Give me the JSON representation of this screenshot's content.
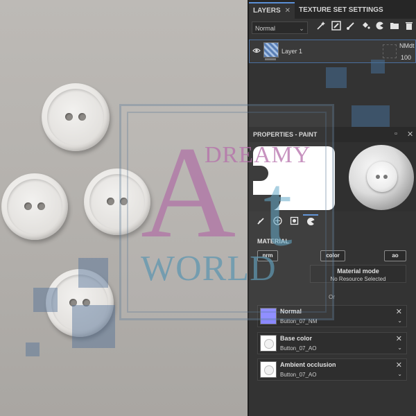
{
  "tabs": {
    "layers": "LAYERS",
    "layers_close": "✕",
    "texture_set": "TEXTURE SET SETTINGS"
  },
  "toolbar": {
    "blend_mode": "Normal",
    "icons": [
      "wand-icon",
      "layer-mask-icon",
      "brush-icon",
      "fill-icon",
      "smart-material-icon",
      "folder-icon",
      "trash-icon"
    ]
  },
  "layer": {
    "name": "Layer 1",
    "channel": "NMdt",
    "opacity": "100"
  },
  "properties": {
    "title": "PROPERTIES - PAINT",
    "section_title": "MATERIAL",
    "channels": [
      "nrm",
      "color",
      "ao"
    ],
    "material_mode_title": "Material mode",
    "material_mode_value": "No Resource Selected",
    "or": "Or",
    "slots": [
      {
        "label": "Normal",
        "value": "Button_07_NM"
      },
      {
        "label": "Base color",
        "value": "Button_07_AO"
      },
      {
        "label": "Ambient occlusion",
        "value": "Button_07_AO"
      }
    ]
  },
  "watermark": {
    "dreamy": "DREAMY",
    "big_a": "A",
    "big_t": "t",
    "world": "WORLD"
  },
  "colors": {
    "accent": "#5a8fd6",
    "panel": "#333333",
    "normal_map": "#8a88ff"
  }
}
